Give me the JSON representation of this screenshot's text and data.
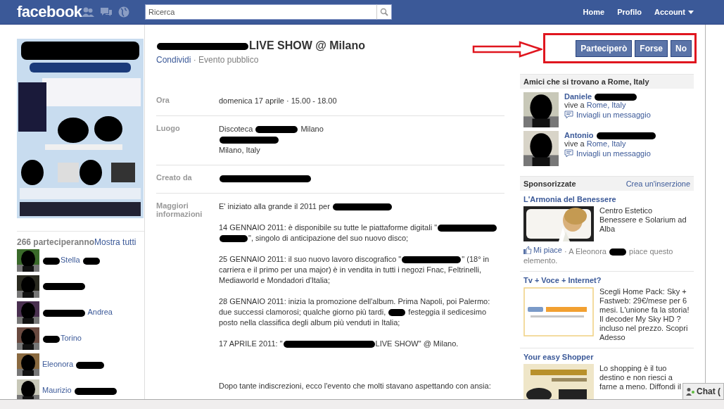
{
  "topbar": {
    "logo": "facebook",
    "search": {
      "placeholder": "Ricerca"
    },
    "nav": [
      {
        "label": "Home",
        "kind": "link"
      },
      {
        "label": "Profilo",
        "kind": "link"
      },
      {
        "label": "Account",
        "kind": "menu"
      }
    ]
  },
  "attendees": {
    "count": "266 parteciperanno",
    "show_all": "Mostra tutti",
    "people": [
      {
        "name": [
          {
            "kind": "redaction_tiny"
          },
          {
            "kind": "text",
            "text": "Stella "
          },
          {
            "kind": "redaction_tiny"
          }
        ]
      },
      {
        "name": [
          {
            "kind": "redaction"
          }
        ]
      },
      {
        "name": [
          {
            "kind": "redaction"
          },
          {
            "kind": "text",
            "text": " Andrea"
          }
        ]
      },
      {
        "name": [
          {
            "kind": "redaction_tiny"
          },
          {
            "kind": "text",
            "text": "Torino"
          }
        ]
      },
      {
        "name": [
          {
            "kind": "text",
            "text": "Eleonora "
          },
          {
            "kind": "redaction_short"
          }
        ]
      },
      {
        "name": [
          {
            "kind": "text",
            "text": "Maurizio "
          },
          {
            "kind": "redaction"
          }
        ]
      }
    ]
  },
  "event": {
    "title": [
      {
        "kind": "redaction_wide"
      },
      {
        "kind": "text",
        "text": "LIVE SHOW @ Milano"
      }
    ],
    "share": "Condividi",
    "visibility": " · Evento pubblico",
    "rsvp": [
      "Parteciperò",
      "Forse",
      "No"
    ],
    "info": [
      {
        "label": "Ora",
        "lines": [
          [
            {
              "kind": "text",
              "text": "domenica 17 aprile · 15.00 - 18.00"
            }
          ]
        ]
      },
      {
        "label": "Luogo",
        "lines": [
          [
            {
              "kind": "text",
              "text": "Discoteca "
            },
            {
              "kind": "redaction"
            },
            {
              "kind": "text",
              "text": " Milano"
            }
          ],
          [
            {
              "kind": "redaction_long"
            }
          ],
          [
            {
              "kind": "text",
              "text": "Milano, Italy"
            }
          ]
        ]
      },
      {
        "label": "Creato da",
        "lines": [
          [
            {
              "kind": "redaction_wide"
            }
          ]
        ]
      },
      {
        "label": "Maggiori informazioni",
        "paragraphs": [
          [
            {
              "kind": "text",
              "text": "E' iniziato alla grande il 2011 per "
            },
            {
              "kind": "redaction_long"
            }
          ],
          [
            {
              "kind": "text",
              "text": "14 GENNAIO 2011: è disponibile su tutte le piattaforme digitali \""
            },
            {
              "kind": "redaction_long"
            },
            {
              "kind": "redaction_short"
            },
            {
              "kind": "text",
              "text": "\", singolo di anticipazione del suo nuovo disco;"
            }
          ],
          [
            {
              "kind": "text",
              "text": "25 GENNAIO 2011: il suo nuovo lavoro discografico \""
            },
            {
              "kind": "redaction_long"
            },
            {
              "kind": "text",
              "text": "\" (18° in carriera e il primo per una major) è in vendita in tutti i negozi Fnac, Feltrinelli, Mediaworld e Mondadori d'Italia;"
            }
          ],
          [
            {
              "kind": "text",
              "text": "28 GENNAIO 2011: inizia la promozione dell'album. Prima Napoli, poi Palermo: due successi clamorosi; qualche giorno più tardi, "
            },
            {
              "kind": "redaction_tiny"
            },
            {
              "kind": "text",
              "text": " festeggia il sedicesimo posto nella classifica degli album più venduti in Italia;"
            }
          ],
          [
            {
              "kind": "text",
              "text": "17 APRILE 2011: \""
            },
            {
              "kind": "redaction_wide"
            },
            {
              "kind": "text",
              "text": "LIVE SHOW\" @ Milano."
            }
          ],
          [
            {
              "kind": "text",
              "text": "Dopo tante indiscrezioni, ecco l'evento che molti stavano aspettando con ansia:"
            }
          ]
        ]
      }
    ]
  },
  "friends": {
    "title": "Amici che si trovano a Rome, Italy",
    "people": [
      {
        "name": [
          {
            "kind": "text",
            "text": "Daniele "
          },
          {
            "kind": "redaction"
          }
        ],
        "lives": "vive a ",
        "place": "Rome, Italy",
        "message": "Inviagli un messaggio"
      },
      {
        "name": [
          {
            "kind": "text",
            "text": "Antonio "
          },
          {
            "kind": "redaction_long"
          }
        ],
        "lives": "vive a ",
        "place": "Rome, Italy",
        "message": "Inviagli un messaggio"
      }
    ]
  },
  "sponsored": {
    "title": "Sponsorizzate",
    "create": "Crea un'inserzione",
    "ads": [
      {
        "title": "L'Armonia del Benessere",
        "kind": "picture",
        "text": "Centro Estetico Benessere e Solarium ad Alba",
        "like": "Mi piace",
        "liked_by": [
          {
            "kind": "text",
            "text": " · A Eleonora "
          },
          {
            "kind": "redaction_tiny"
          },
          {
            "kind": "text",
            "text": " piace questo elemento."
          }
        ]
      },
      {
        "title": "Tv + Voce + Internet?",
        "kind": "picture",
        "text": "Scegli Home Pack: Sky + Fastweb: 29€/mese per 6 mesi. L'unione fa la storia! Il decoder My Sky HD ? incluso nel prezzo. Scopri Adesso"
      },
      {
        "title": "Your easy Shopper",
        "kind": "picture",
        "text": "Lo shopping è il tuo destino e non riesci a farne a meno. Diffondi il"
      }
    ]
  },
  "chat": {
    "label": "Chat ("
  }
}
